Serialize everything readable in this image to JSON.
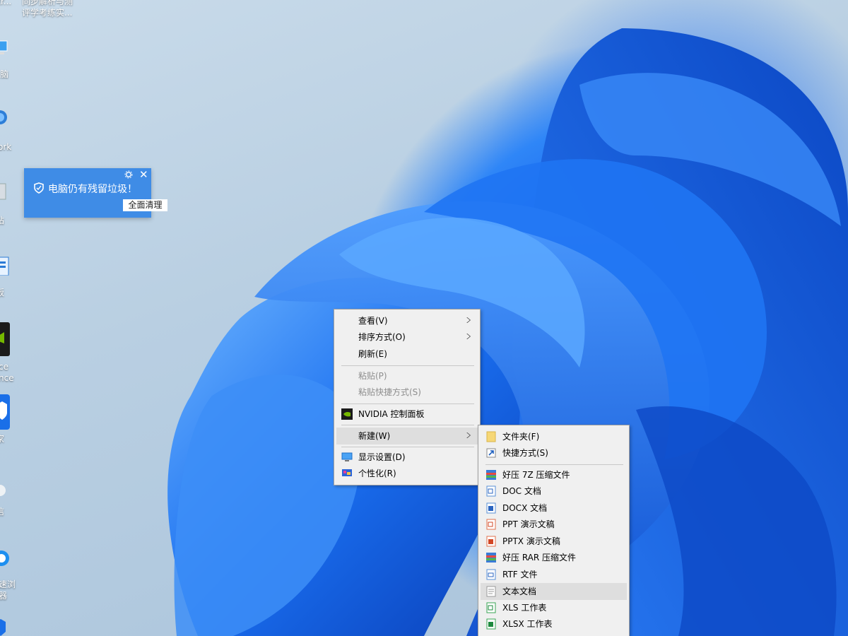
{
  "desktop_icons": [
    {
      "label": "str..."
    },
    {
      "label": "同步解析与测\n评学考练实..."
    },
    {
      "label": "脑"
    },
    {
      "label": "ork"
    },
    {
      "label": "站"
    },
    {
      "label": "板"
    },
    {
      "label": "ce\nnce"
    },
    {
      "label": "家"
    },
    {
      "label": "信"
    },
    {
      "label": "速浏\n器"
    }
  ],
  "notification": {
    "message": "电脑仍有残留垃圾！",
    "button": "全面清理"
  },
  "context_menu": {
    "items": [
      {
        "label": "查看(V)",
        "submenu": true
      },
      {
        "label": "排序方式(O)",
        "submenu": true
      },
      {
        "label": "刷新(E)"
      },
      {
        "label": "粘贴(P)",
        "disabled": true
      },
      {
        "label": "粘贴快捷方式(S)",
        "disabled": true
      },
      {
        "label": "NVIDIA 控制面板",
        "icon": "nvidia-icon"
      },
      {
        "label": "新建(W)",
        "submenu": true,
        "highlighted": true
      },
      {
        "label": "显示设置(D)",
        "icon": "display-icon"
      },
      {
        "label": "个性化(R)",
        "icon": "personalize-icon"
      }
    ]
  },
  "new_submenu": {
    "items": [
      {
        "label": "文件夹(F)",
        "icon": "folder-icon"
      },
      {
        "label": "快捷方式(S)",
        "icon": "shortcut-icon"
      },
      {
        "label": "好压 7Z 压缩文件",
        "icon": "archive-icon"
      },
      {
        "label": "DOC 文档",
        "icon": "doc-icon"
      },
      {
        "label": "DOCX 文档",
        "icon": "docx-icon"
      },
      {
        "label": "PPT 演示文稿",
        "icon": "ppt-icon"
      },
      {
        "label": "PPTX 演示文稿",
        "icon": "pptx-icon"
      },
      {
        "label": "好压 RAR 压缩文件",
        "icon": "archive-icon"
      },
      {
        "label": "RTF 文件",
        "icon": "rtf-icon"
      },
      {
        "label": "文本文档",
        "icon": "text-icon",
        "highlighted": true
      },
      {
        "label": "XLS 工作表",
        "icon": "xls-icon"
      },
      {
        "label": "XLSX 工作表",
        "icon": "xlsx-icon"
      }
    ]
  },
  "colors": {
    "accent": "#3f8ce6",
    "menu_bg": "#f0f0f0",
    "menu_highlight": "#dedede",
    "disabled_text": "#8e8e8e"
  }
}
